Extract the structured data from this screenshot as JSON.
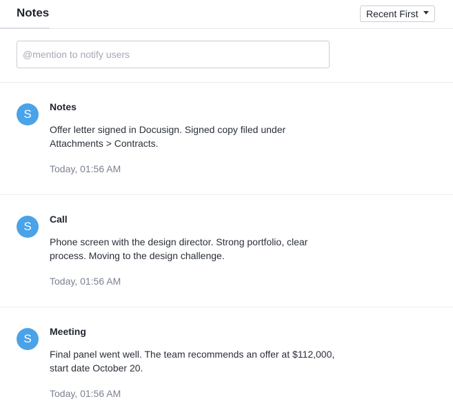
{
  "header": {
    "title": "Notes",
    "sort_label": "Recent First"
  },
  "compose": {
    "placeholder": "@mention to notify users"
  },
  "notes": [
    {
      "avatar": "S",
      "title": "Notes",
      "body": "Offer letter signed in Docusign. Signed copy filed under Attachments > Contracts.",
      "time": "Today, 01:56 AM"
    },
    {
      "avatar": "S",
      "title": "Call",
      "body": "Phone screen with the design director. Strong portfolio, clear process. Moving to the design challenge.",
      "time": "Today, 01:56 AM"
    },
    {
      "avatar": "S",
      "title": "Meeting",
      "body": "Final panel went well. The team recommends an offer at $112,000, start date October 20.",
      "time": "Today, 01:56 AM"
    }
  ],
  "colors": {
    "avatar": "#4aa3e8",
    "border": "#c9ccd3",
    "timestamp": "#7b8190"
  },
  "icons": {
    "sort_caret": "caret-down-icon"
  }
}
